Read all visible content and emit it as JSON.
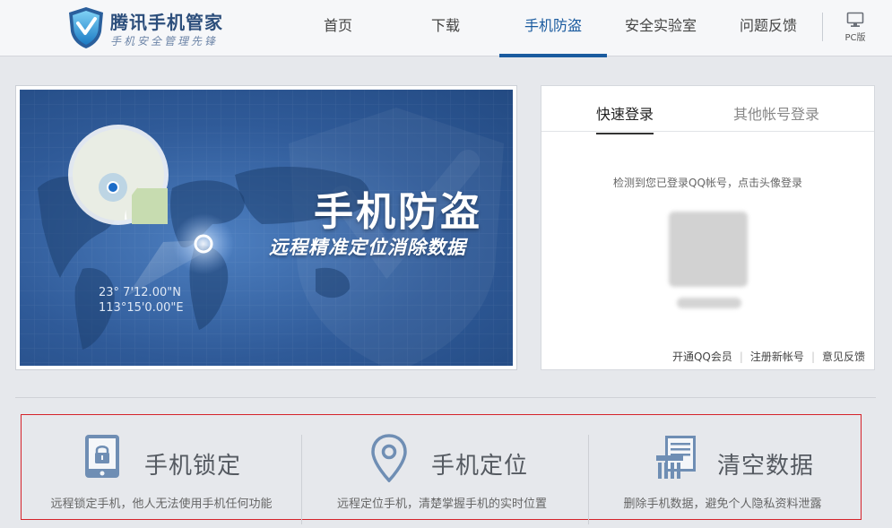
{
  "header": {
    "logo_title": "腾讯手机管家",
    "logo_slogan": "手机安全管理先锋",
    "nav": [
      {
        "label": "首页",
        "active": false
      },
      {
        "label": "下载",
        "active": false
      },
      {
        "label": "手机防盗",
        "active": true
      },
      {
        "label": "安全实验室",
        "active": false
      },
      {
        "label": "问题反馈",
        "active": false
      }
    ],
    "pc_label": "PC版",
    "accent_color": "#1a5b9f"
  },
  "banner": {
    "title": "手机防盗",
    "subtitle": "远程精准定位消除数据",
    "coord_lat": "23° 7'12.00\"N",
    "coord_lon": "113°15'0.00\"E"
  },
  "login": {
    "tabs": [
      {
        "label": "快速登录",
        "active": true
      },
      {
        "label": "其他帐号登录",
        "active": false
      }
    ],
    "hint": "检测到您已登录QQ帐号，点击头像登录",
    "links": [
      "开通QQ会员",
      "注册新帐号",
      "意见反馈"
    ]
  },
  "features": [
    {
      "icon": "phone-lock-icon",
      "title": "手机锁定",
      "desc": "远程锁定手机，他人无法使用手机任何功能"
    },
    {
      "icon": "location-pin-icon",
      "title": "手机定位",
      "desc": "远程定位手机，清楚掌握手机的实时位置"
    },
    {
      "icon": "shredder-icon",
      "title": "清空数据",
      "desc": "删除手机数据，避免个人隐私资料泄露"
    }
  ]
}
